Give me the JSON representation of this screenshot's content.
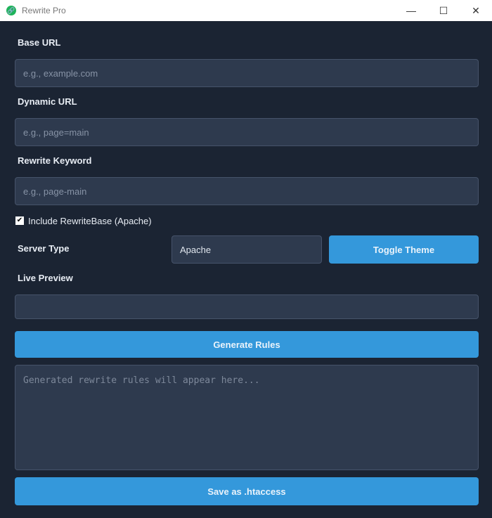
{
  "window": {
    "title": "Rewrite Pro",
    "minimize": "—",
    "maximize": "☐",
    "close": "✕"
  },
  "base_url": {
    "label": "Base URL",
    "placeholder": "e.g., example.com"
  },
  "dynamic_url": {
    "label": "Dynamic URL",
    "placeholder": "e.g., page=main"
  },
  "rewrite_keyword": {
    "label": "Rewrite Keyword",
    "placeholder": "e.g., page-main"
  },
  "rewrite_base": {
    "label": "Include RewriteBase (Apache)",
    "checked": true,
    "mark": "✔"
  },
  "server_type": {
    "label": "Server Type",
    "value": "Apache"
  },
  "toggle_theme": "Toggle Theme",
  "live_preview": {
    "label": "Live Preview",
    "value": ""
  },
  "generate": "Generate Rules",
  "output": {
    "placeholder": "Generated rewrite rules will appear here..."
  },
  "save": "Save as .htaccess"
}
